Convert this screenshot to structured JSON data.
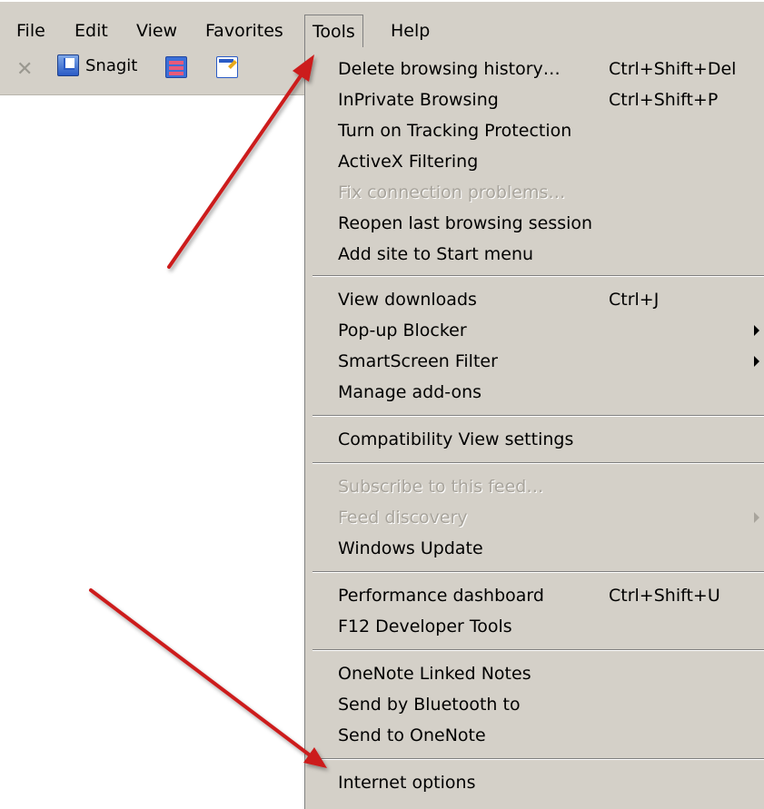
{
  "menubar": {
    "items": [
      {
        "label": "File"
      },
      {
        "label": "Edit"
      },
      {
        "label": "View"
      },
      {
        "label": "Favorites"
      },
      {
        "label": "Tools"
      },
      {
        "label": "Help"
      }
    ]
  },
  "toolbar": {
    "stop_icon": "close-icon",
    "snagit_label": "Snagit"
  },
  "tools_menu": {
    "items": [
      {
        "label": "Delete browsing history…",
        "shortcut": "Ctrl+Shift+Del",
        "enabled": true
      },
      {
        "label": "InPrivate Browsing",
        "shortcut": "Ctrl+Shift+P",
        "enabled": true
      },
      {
        "label": "Turn on Tracking Protection",
        "shortcut": "",
        "enabled": true
      },
      {
        "label": "ActiveX Filtering",
        "shortcut": "",
        "enabled": true
      },
      {
        "label": "Fix connection problems…",
        "shortcut": "",
        "enabled": false
      },
      {
        "label": "Reopen last browsing session",
        "shortcut": "",
        "enabled": true
      },
      {
        "label": "Add site to Start menu",
        "shortcut": "",
        "enabled": true
      },
      {
        "label": "View downloads",
        "shortcut": "Ctrl+J",
        "enabled": true
      },
      {
        "label": "Pop-up Blocker",
        "shortcut": "",
        "enabled": true,
        "submenu": true
      },
      {
        "label": "SmartScreen Filter",
        "shortcut": "",
        "enabled": true,
        "submenu": true
      },
      {
        "label": "Manage add-ons",
        "shortcut": "",
        "enabled": true
      },
      {
        "label": "Compatibility View settings",
        "shortcut": "",
        "enabled": true
      },
      {
        "label": "Subscribe to this feed…",
        "shortcut": "",
        "enabled": false
      },
      {
        "label": "Feed discovery",
        "shortcut": "",
        "enabled": false,
        "submenu": true
      },
      {
        "label": "Windows Update",
        "shortcut": "",
        "enabled": true
      },
      {
        "label": "Performance dashboard",
        "shortcut": "Ctrl+Shift+U",
        "enabled": true
      },
      {
        "label": "F12 Developer Tools",
        "shortcut": "",
        "enabled": true
      },
      {
        "label": "OneNote Linked Notes",
        "shortcut": "",
        "enabled": true
      },
      {
        "label": "Send by Bluetooth to",
        "shortcut": "",
        "enabled": true
      },
      {
        "label": "Send to OneNote",
        "shortcut": "",
        "enabled": true
      },
      {
        "label": "Internet options",
        "shortcut": "",
        "enabled": true
      }
    ]
  },
  "colors": {
    "menu_background": "#d4d0c8",
    "disabled_text": "#a8a49c",
    "annotation_arrow": "#cc1a1a"
  }
}
